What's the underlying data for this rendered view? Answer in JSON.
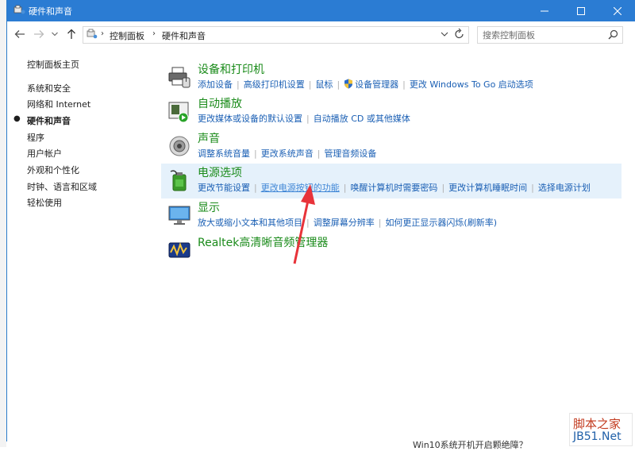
{
  "window": {
    "title": "硬件和声音",
    "minimize_label": "minimize",
    "maximize_label": "maximize",
    "close_label": "close"
  },
  "address": {
    "crumbs": [
      "控制面板",
      "硬件和声音"
    ],
    "search_placeholder": "搜索控制面板"
  },
  "sidebar": {
    "items": [
      {
        "label": "控制面板主页",
        "active": false
      },
      {
        "label": "系统和安全",
        "active": false
      },
      {
        "label": "网络和 Internet",
        "active": false
      },
      {
        "label": "硬件和声音",
        "active": true
      },
      {
        "label": "程序",
        "active": false
      },
      {
        "label": "用户帐户",
        "active": false
      },
      {
        "label": "外观和个性化",
        "active": false
      },
      {
        "label": "时钟、语言和区域",
        "active": false
      },
      {
        "label": "轻松使用",
        "active": false
      }
    ]
  },
  "sections": [
    {
      "title": "设备和打印机",
      "icon": "printer-icon",
      "links": [
        "添加设备",
        "高级打印机设置",
        "鼠标",
        "设备管理器",
        "更改 Windows To Go 启动选项"
      ]
    },
    {
      "title": "自动播放",
      "icon": "autoplay-icon",
      "links": [
        "更改媒体或设备的默认设置",
        "自动播放 CD 或其他媒体"
      ]
    },
    {
      "title": "声音",
      "icon": "speaker-icon",
      "links": [
        "调整系统音量",
        "更改系统声音",
        "管理音频设备"
      ]
    },
    {
      "title": "电源选项",
      "icon": "battery-icon",
      "links": [
        "更改节能设置",
        "更改电源按钮的功能",
        "唤醒计算机时需要密码",
        "更改计算机睡眠时间",
        "选择电源计划"
      ]
    },
    {
      "title": "显示",
      "icon": "monitor-icon",
      "links": [
        "放大或缩小文本和其他项目",
        "调整屏幕分辨率",
        "如何更正显示器闪烁(刷新率)"
      ]
    },
    {
      "title": "Realtek高清晰音频管理器",
      "icon": "realtek-icon",
      "links": []
    }
  ],
  "background": {
    "status_text": "Win10系统开机开启颗绝障？",
    "watermark_line1": "脚本之家",
    "watermark_line2": "JB51.Net"
  },
  "colors": {
    "titlebar": "#2b7cd3",
    "section_title": "#1a8b1a",
    "link": "#1a5fb4",
    "highlight": "#e5f1fb",
    "arrow": "#e8333a"
  }
}
